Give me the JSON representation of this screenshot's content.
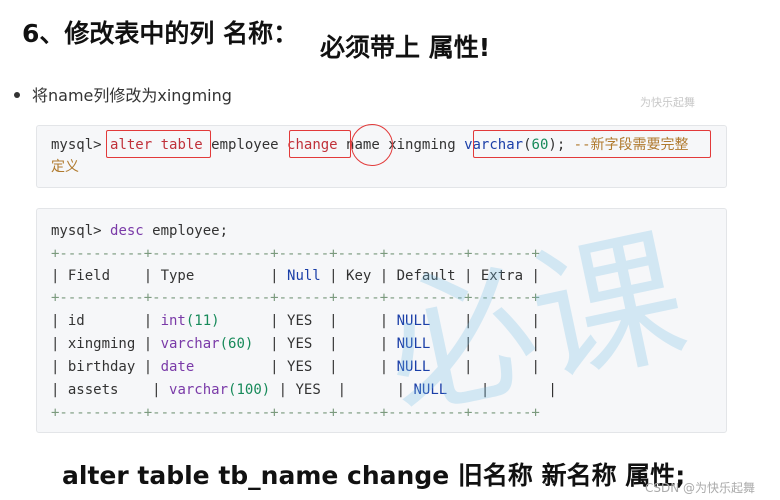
{
  "heading": {
    "title": "6、修改表中的列 名称：",
    "emphasis": "必须带上 属性!"
  },
  "bullet": {
    "text": "将name列修改为xingming"
  },
  "watermark": {
    "small": "为快乐起舞",
    "big": "必课",
    "footer": "CSDN @为快乐起舞"
  },
  "alter_cmd": {
    "prompt": "mysql> ",
    "kw1": "alter table",
    "table": " employee ",
    "kw2": "change",
    "old": "name",
    "new": " xingming ",
    "type_name": "varchar",
    "type_paren_open": "(",
    "type_len": "60",
    "type_paren_close": ")",
    "semi": "; ",
    "comment_line1": "--新字段需要完整",
    "comment_line2": "定义"
  },
  "desc_cmd": {
    "prompt": "mysql> ",
    "kw": "desc",
    "rest": " employee;"
  },
  "table": {
    "border": "+----------+--------------+------+-----+---------+-------+",
    "headers": {
      "field": "| Field    ",
      "type": "| Type         ",
      "null_sep": "| ",
      "null": "Null",
      "key": " | Key | Default | Extra |"
    },
    "rows": [
      {
        "field": "| id       | ",
        "type_fn": "int",
        "type_arg": "(11)",
        "type_pad": "      ",
        "null": "| YES  |     | ",
        "default": "NULL",
        "tail": "    |       |"
      },
      {
        "field": "| xingming | ",
        "type_fn": "varchar",
        "type_arg": "(60)",
        "type_pad": "  ",
        "null": "| YES  |     | ",
        "default": "NULL",
        "tail": "    |       |"
      },
      {
        "field": "| birthday | ",
        "type_fn": "date",
        "type_arg": "",
        "type_pad": "         ",
        "null": "| YES  |     | ",
        "default": "NULL",
        "tail": "    |       |"
      },
      {
        "field": "| assets    | ",
        "type_fn": "varchar",
        "type_arg": "(100)",
        "type_pad": " ",
        "null": "| YES  |      | ",
        "default": "NULL",
        "tail": "    |       |"
      }
    ]
  },
  "footer": {
    "text": "alter table  tb_name  change  旧名称  新名称  属性;"
  }
}
